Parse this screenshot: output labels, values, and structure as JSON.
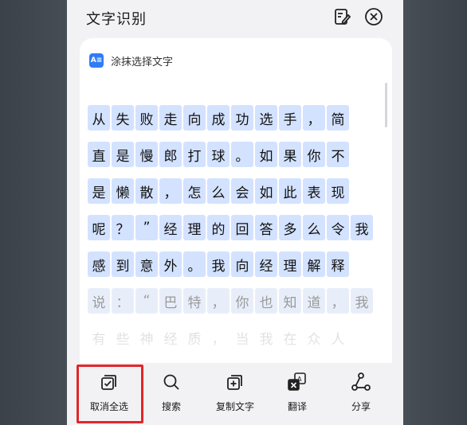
{
  "header": {
    "title": "文字识别"
  },
  "card": {
    "hint": "涂抹选择文字",
    "icon_text": "A≡"
  },
  "text_rows": [
    {
      "style": "selected",
      "chars": [
        "从",
        "失",
        "败",
        "走",
        "向",
        "成",
        "功",
        "选",
        "手",
        "，",
        "简"
      ]
    },
    {
      "style": "selected",
      "chars": [
        "直",
        "是",
        "慢",
        "郎",
        "打",
        "球",
        "。",
        "如",
        "果",
        "你",
        "不"
      ]
    },
    {
      "style": "selected",
      "chars": [
        "是",
        "懒",
        "散",
        "，",
        "怎",
        "么",
        "会",
        "如",
        "此",
        "表",
        "现"
      ]
    },
    {
      "style": "selected",
      "chars": [
        "呢",
        "？",
        "”",
        "经",
        "理",
        "的",
        "回",
        "答",
        "多",
        "么",
        "令",
        "我"
      ]
    },
    {
      "style": "selected",
      "chars": [
        "感",
        "到",
        "意",
        "外",
        "。",
        "我",
        "向",
        "经",
        "理",
        "解",
        "释"
      ]
    },
    {
      "style": "faded",
      "chars": [
        "说",
        "：",
        "“",
        "巴",
        "特",
        "，",
        "你",
        "也",
        "知",
        "道",
        "，",
        "我"
      ]
    },
    {
      "style": "ghost",
      "chars": [
        "有",
        "些",
        "神",
        "经",
        "质",
        "，",
        "当",
        "我",
        "在",
        "众",
        "人"
      ]
    }
  ],
  "toolbar": {
    "deselect_all": "取消全选",
    "search": "搜索",
    "copy_text": "复制文字",
    "translate": "翻译",
    "share": "分享"
  },
  "colors": {
    "highlight_box": "#e2262a",
    "char_selected_bg": "#d3e2ff",
    "accent": "#2f7cf6"
  },
  "icons": [
    "edit-icon",
    "close-icon",
    "text-recognition-icon",
    "checkbox-icon",
    "search-icon",
    "copy-icon",
    "translate-icon",
    "share-icon"
  ]
}
